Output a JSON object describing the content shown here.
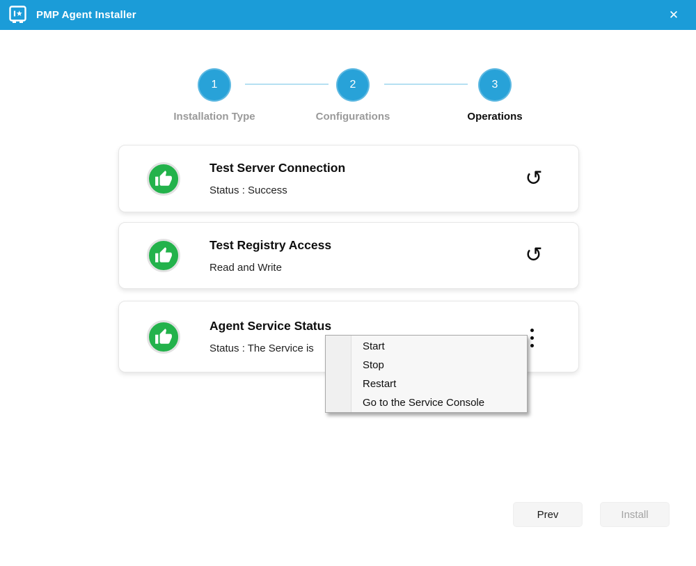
{
  "window": {
    "title": "PMP Agent Installer",
    "close_glyph": "✕"
  },
  "stepper": {
    "steps": [
      {
        "number": "1",
        "label": "Installation Type",
        "state": "completed"
      },
      {
        "number": "2",
        "label": "Configurations",
        "state": "completed"
      },
      {
        "number": "3",
        "label": "Operations",
        "state": "active"
      }
    ]
  },
  "cards": [
    {
      "title": "Test Server Connection",
      "status": "Status : Success",
      "result": "success",
      "action_icon": "retry-icon"
    },
    {
      "title": "Test Registry Access",
      "status": "Read and Write",
      "result": "success",
      "action_icon": "retry-icon"
    },
    {
      "title": "Agent Service Status",
      "status": "Status : The Service is",
      "result": "success",
      "action_icon": "kebab-menu-icon"
    }
  ],
  "context_menu": {
    "items": [
      {
        "label": "Start"
      },
      {
        "label": "Stop"
      },
      {
        "label": "Restart"
      },
      {
        "label": "Go to the Service Console"
      }
    ]
  },
  "footer": {
    "prev_label": "Prev",
    "install_label": "Install",
    "install_enabled": false
  },
  "icons": {
    "retry_glyph": "↺"
  },
  "colors": {
    "titlebar": "#1b9cd8",
    "circle": "#28a2d8",
    "connector": "#b5e0f2",
    "green": "#23b24b",
    "gray_label": "#9a9a9a"
  }
}
